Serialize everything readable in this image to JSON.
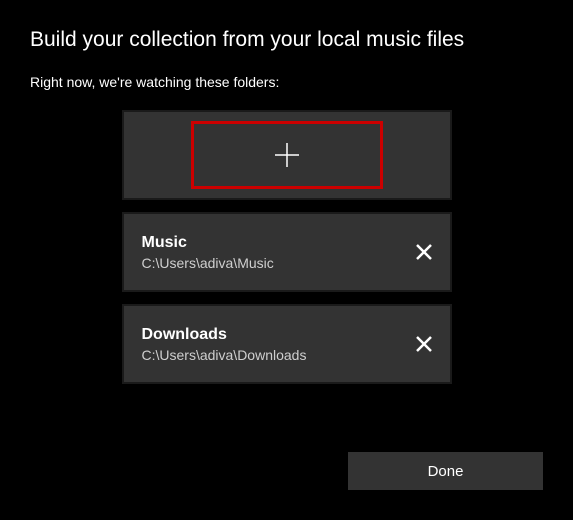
{
  "title": "Build your collection from your local music files",
  "subtitle": "Right now, we're watching these folders:",
  "folders": [
    {
      "name": "Music",
      "path": "C:\\Users\\adiva\\Music"
    },
    {
      "name": "Downloads",
      "path": "C:\\Users\\adiva\\Downloads"
    }
  ],
  "done_label": "Done"
}
